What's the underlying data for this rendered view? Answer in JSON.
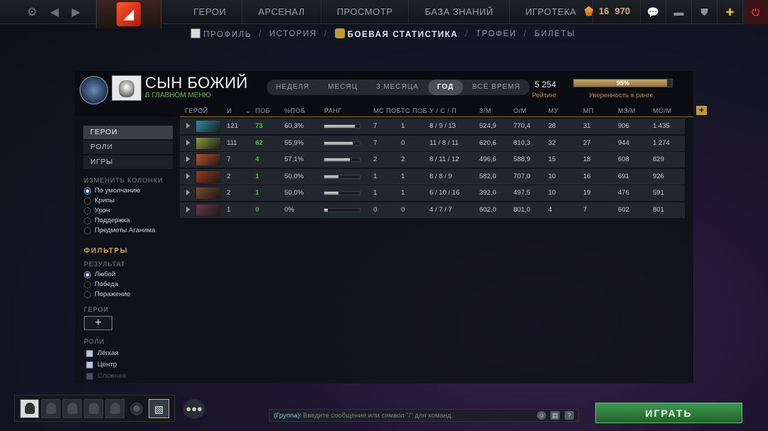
{
  "top_nav": {
    "items": [
      "ГЕРОИ",
      "АРСЕНАЛ",
      "ПРОСМОТР",
      "БАЗА ЗНАНИЙ",
      "ИГРОТЕКА"
    ],
    "currency": [
      "16",
      "970"
    ]
  },
  "sub_nav": {
    "items": [
      "ПРОФИЛЬ",
      "ИСТОРИЯ",
      "БОЕВАЯ СТАТИСТИКА",
      "ТРОФЕИ",
      "БИЛЕТЫ"
    ],
    "separator": "/",
    "active": "БОЕВАЯ СТАТИСТИКА"
  },
  "profile": {
    "name": "СЫН БОЖИЙ",
    "status": "В ГЛАВНОМ МЕНЮ",
    "rating_value": "5 254",
    "rating_label": "Рейтинг",
    "confidence_value": "95%",
    "confidence_fraction": 0.95,
    "confidence_label": "Уверенность в ранге"
  },
  "periods": {
    "options": [
      "НЕДЕЛЯ",
      "МЕСЯЦ",
      "3 МЕСЯЦА",
      "ГОД",
      "ВСЁ ВРЕМЯ"
    ],
    "selected": "ГОД"
  },
  "table": {
    "columns": [
      "ГЕРОЙ",
      "И",
      "ПОБ",
      "%ПОБ",
      "РАНГ",
      "МС ПОБ",
      "ТС ПОБ",
      "У / С / П",
      "З/М",
      "О/М",
      "МУ",
      "МП",
      "МЗ/М",
      "МО/М"
    ],
    "add_column_label": "+",
    "rows": [
      {
        "hero_color": "#2b8ea6",
        "games": "121",
        "wins": "73",
        "winrate": "60,3%",
        "rank": 0.85,
        "ms": "7",
        "ts": "1",
        "kda": "8 / 9 / 13",
        "gpm": "524,9",
        "xpm": "770,4",
        "mk": "28",
        "md": "31",
        "mgpm": "906",
        "mxpm": "1 435"
      },
      {
        "hero_color": "#8a9a3a",
        "games": "111",
        "wins": "62",
        "winrate": "55,9%",
        "rank": 0.8,
        "ms": "7",
        "ts": "0",
        "kda": "11 / 8 / 11",
        "gpm": "620,6",
        "xpm": "810,3",
        "mk": "32",
        "md": "27",
        "mgpm": "944",
        "mxpm": "1 274"
      },
      {
        "hero_color": "#b8512a",
        "games": "7",
        "wins": "4",
        "winrate": "57,1%",
        "rank": 0.72,
        "ms": "2",
        "ts": "2",
        "kda": "8 / 11 / 12",
        "gpm": "496,6",
        "xpm": "588,9",
        "mk": "15",
        "md": "18",
        "mgpm": "608",
        "mxpm": "829"
      },
      {
        "hero_color": "#9a3a1e",
        "games": "2",
        "wins": "1",
        "winrate": "50,0%",
        "rank": 0.4,
        "ms": "1",
        "ts": "1",
        "kda": "8 / 8 / 9",
        "gpm": "582,0",
        "xpm": "707,0",
        "mk": "10",
        "md": "16",
        "mgpm": "691",
        "mxpm": "926"
      },
      {
        "hero_color": "#7a4a2a",
        "games": "2",
        "wins": "1",
        "winrate": "50,0%",
        "rank": 0.4,
        "ms": "1",
        "ts": "1",
        "kda": "6 / 10 / 16",
        "gpm": "392,0",
        "xpm": "497,5",
        "mk": "10",
        "md": "19",
        "mgpm": "476",
        "mxpm": "591"
      },
      {
        "hero_color": "#6a3a4a",
        "games": "1",
        "wins": "0",
        "winrate": "0%",
        "rank": 0.1,
        "ms": "0",
        "ts": "0",
        "kda": "4 / 7 / 7",
        "gpm": "602,0",
        "xpm": "801,0",
        "mk": "4",
        "md": "7",
        "mgpm": "602",
        "mxpm": "801"
      }
    ]
  },
  "sidebar": {
    "tabs": [
      "ГЕРОИ",
      "РОЛИ",
      "ИГРЫ"
    ],
    "selected_tab": "ГЕРОИ",
    "columns_label": "ИЗМЕНИТЬ КОЛОНКИ",
    "column_options": [
      "По умолчанию",
      "Крипы",
      "Урон",
      "Поддержка",
      "Предметы Аганима"
    ],
    "column_selected": "По умолчанию",
    "filters_label": "ФИЛЬТРЫ",
    "result_label": "РЕЗУЛЬТАТ",
    "result_options": [
      "Любой",
      "Победа",
      "Поражение"
    ],
    "result_selected": "Любой",
    "heroes_label": "ГЕРОИ",
    "add_hero_label": "+",
    "roles_label": "РОЛИ",
    "roles": [
      "Лёгкая",
      "Центр",
      "Сложная"
    ]
  },
  "chat": {
    "group_prefix": "(Группа):",
    "placeholder": "Введите сообщение или символ \"/\" для команд."
  },
  "play_button": "ИГРАТЬ"
}
